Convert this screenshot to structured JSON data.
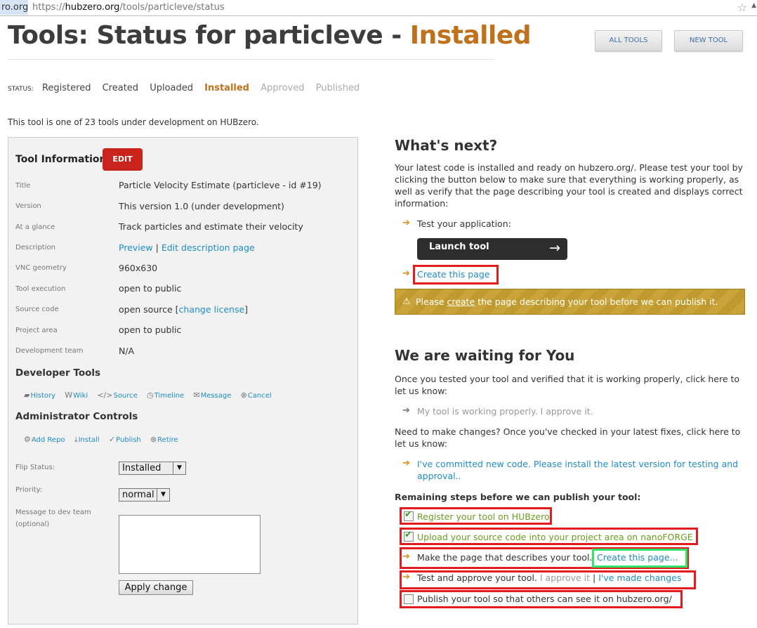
{
  "browser": {
    "domain_fragment": "ro.org",
    "url_prefix": "https://",
    "url_host": "hubzero.org",
    "url_path": "/tools/particleve/status"
  },
  "header": {
    "title_prefix": "Tools: Status for particleve - ",
    "title_status": "Installed",
    "all_tools": "ALL TOOLS",
    "new_tool": "NEW TOOL"
  },
  "steps": {
    "label": "STATUS:",
    "items": [
      "Registered",
      "Created",
      "Uploaded",
      "Installed",
      "Approved",
      "Published"
    ],
    "current": "Installed"
  },
  "intro": "This tool is one of 23 tools under development on HUBzero.",
  "tool_info": {
    "title": "Tool Information",
    "edit": "EDIT",
    "rows": [
      {
        "label": "Title",
        "value": "Particle Velocity Estimate (particleve - id #19)"
      },
      {
        "label": "Version",
        "value": "This version 1.0 (under development)"
      },
      {
        "label": "At a glance",
        "value": "Track particles and estimate their velocity"
      },
      {
        "label": "Description",
        "link1": "Preview",
        "sep": " | ",
        "link2": "Edit description page"
      },
      {
        "label": "VNC geometry",
        "value": "960x630"
      },
      {
        "label": "Tool execution",
        "value": "open to public"
      },
      {
        "label": "Source code",
        "value": "open source [",
        "link": "change license",
        "tail": "]"
      },
      {
        "label": "Project area",
        "value": "open to public"
      },
      {
        "label": "Development team",
        "value": "N/A"
      }
    ],
    "dev_tools_title": "Developer Tools",
    "dev_tools": [
      "History",
      "Wiki",
      "Source",
      "Timeline",
      "Message",
      "Cancel"
    ],
    "admin_title": "Administrator Controls",
    "admin_tools": [
      "Add Repo",
      "Install",
      "Publish",
      "Retire"
    ],
    "flip_status_label": "Flip Status:",
    "flip_status_value": "Installed",
    "priority_label": "Priority:",
    "priority_value": "normal",
    "message_label": "Message to dev team",
    "message_optional": "(optional)",
    "apply": "Apply change"
  },
  "whats_next": {
    "heading": "What's next?",
    "para": "Your latest code is installed and ready on hubzero.org/. Please test your tool by clicking the button below to make sure that everything is working properly, as well as verify that the page describing your tool is created and displays correct information:",
    "test_app": "Test your application:",
    "launch": "Launch tool",
    "create_page": "Create this page",
    "warn_pre": "Please ",
    "warn_link": "create",
    "warn_post": " the page describing your tool before we can publish it."
  },
  "waiting": {
    "heading": "We are waiting for You",
    "para1": "Once you tested your tool and verified that it is working properly, click here to let us know:",
    "approve": "My tool is working properly. I approve it.",
    "para2": "Need to make changes? Once you've checked in your latest fixes, click here to let us know:",
    "committed_line1": "I've committed new code. Please install the latest version for testing and",
    "committed_line2": "approval..",
    "remaining": "Remaining steps before we can publish your tool:",
    "step1": "Register your tool on HUBzero",
    "step2": "Upload your source code into your project area on nanoFORGE",
    "step3_text": "Make the page that describes your tool.",
    "step3_link": "Create this page...",
    "step4_text": "Test and approve your tool. ",
    "step4_approve": "I approve it",
    "step4_sep": " | ",
    "step4_link": "I've made changes",
    "step5": "Publish your tool so that others can see it on hubzero.org/"
  }
}
